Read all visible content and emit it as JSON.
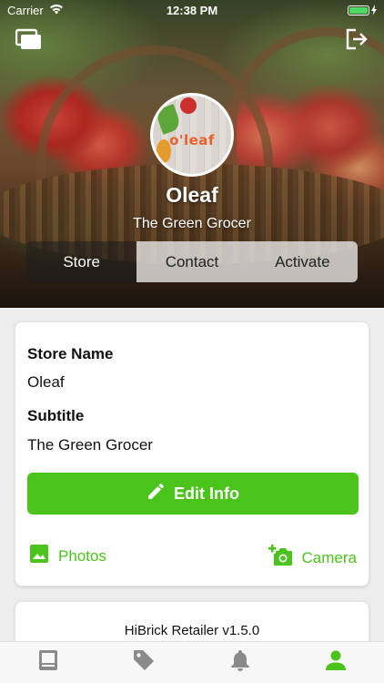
{
  "status_bar": {
    "carrier": "Carrier",
    "time": "12:38 PM"
  },
  "header": {
    "left_icon": "gallery-icon",
    "right_icon": "logout-icon"
  },
  "profile": {
    "logo_text": "o'leaf",
    "name": "Oleaf",
    "subtitle": "The Green Grocer"
  },
  "segments": [
    {
      "label": "Store",
      "active": true
    },
    {
      "label": "Contact",
      "active": false
    },
    {
      "label": "Activate",
      "active": false
    }
  ],
  "info_card": {
    "store_name_label": "Store Name",
    "store_name_value": "Oleaf",
    "subtitle_label": "Subtitle",
    "subtitle_value": "The Green Grocer",
    "edit_button": "Edit Info",
    "photos_button": "Photos",
    "camera_button": "Camera"
  },
  "version_text": "HiBrick Retailer v1.5.0",
  "tabbar": {
    "tabs": [
      {
        "icon": "catalog-icon",
        "active": false
      },
      {
        "icon": "tag-icon",
        "active": false
      },
      {
        "icon": "bell-icon",
        "active": false
      },
      {
        "icon": "profile-icon",
        "active": true
      }
    ]
  },
  "colors": {
    "accent": "#4ac31b",
    "battery": "#4cd964",
    "inactive_icon": "#8a8a8a"
  }
}
